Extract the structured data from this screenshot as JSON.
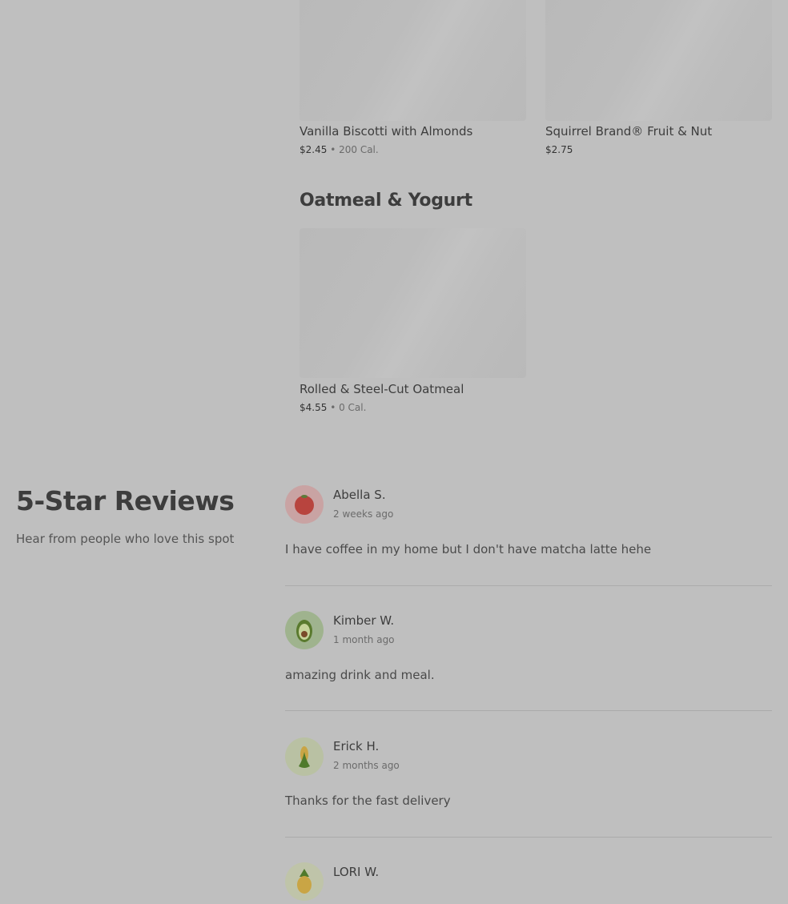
{
  "menu": {
    "top_items": [
      {
        "name": "Vanilla Biscotti with Almonds",
        "price": "$2.45",
        "separator": "•",
        "calories": "200 Cal."
      },
      {
        "name": "Squirrel Brand® Fruit & Nut",
        "price": "$2.75"
      }
    ],
    "oatmeal_section": {
      "title": "Oatmeal & Yogurt",
      "items": [
        {
          "name": "Rolled & Steel-Cut Oatmeal",
          "price": "$4.55",
          "separator": "•",
          "calories": "0 Cal."
        }
      ]
    }
  },
  "reviews": {
    "title": "5-Star Reviews",
    "subtitle": "Hear from people who love this spot",
    "items": [
      {
        "name": "Abella S.",
        "time": "2 weeks ago",
        "text": "I have coffee in my home but I don't have matcha latte hehe",
        "avatar_icon": "tomato-icon",
        "avatar_bg": "#c9a3a3"
      },
      {
        "name": "Kimber W.",
        "time": "1 month ago",
        "text": "amazing drink and meal.",
        "avatar_icon": "avocado-icon",
        "avatar_bg": "#9fb38e"
      },
      {
        "name": "Erick H.",
        "time": "2 months ago",
        "text": "Thanks for the fast delivery",
        "avatar_icon": "corn-icon",
        "avatar_bg": "#b9c1a3"
      },
      {
        "name": "LORI W.",
        "avatar_icon": "pineapple-icon",
        "avatar_bg": "#bfc4a9"
      }
    ]
  }
}
